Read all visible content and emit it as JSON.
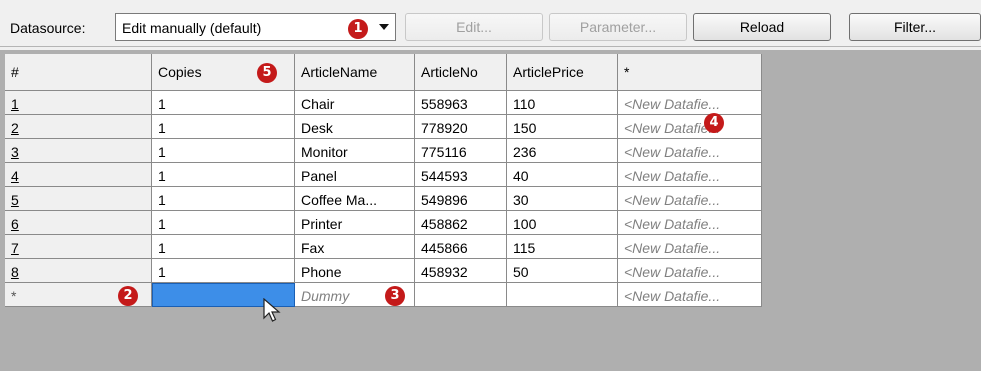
{
  "toolbar": {
    "datasource_label": "Datasource:",
    "datasource_value": "Edit manually (default)",
    "edit_label": "Edit...",
    "parameter_label": "Parameter...",
    "reload_label": "Reload",
    "filter_label": "Filter..."
  },
  "badges": {
    "b1": "1",
    "b2": "2",
    "b3": "3",
    "b4": "4",
    "b5": "5"
  },
  "table": {
    "headers": [
      "#",
      "Copies",
      "ArticleName",
      "ArticleNo",
      "ArticlePrice",
      "*"
    ],
    "rows": [
      [
        "1",
        "1",
        "Chair",
        "558963",
        "110",
        "<New Datafie..."
      ],
      [
        "2",
        "1",
        "Desk",
        "778920",
        "150",
        "<New Datafie..."
      ],
      [
        "3",
        "1",
        "Monitor",
        "775116",
        "236",
        "<New Datafie..."
      ],
      [
        "4",
        "1",
        "Panel",
        "544593",
        "40",
        "<New Datafie..."
      ],
      [
        "5",
        "1",
        "Coffee Ma...",
        "549896",
        "30",
        "<New Datafie..."
      ],
      [
        "6",
        "1",
        "Printer",
        "458862",
        "100",
        "<New Datafie..."
      ],
      [
        "7",
        "1",
        "Fax",
        "445866",
        "115",
        "<New Datafie..."
      ],
      [
        "8",
        "1",
        "Phone",
        "458932",
        "50",
        "<New Datafie..."
      ]
    ],
    "new_row": [
      "*",
      "",
      "Dummy",
      "",
      "",
      "<New Datafie..."
    ]
  },
  "colors": {
    "badge": "#c41a1a",
    "selection": "#3d8ee8"
  }
}
